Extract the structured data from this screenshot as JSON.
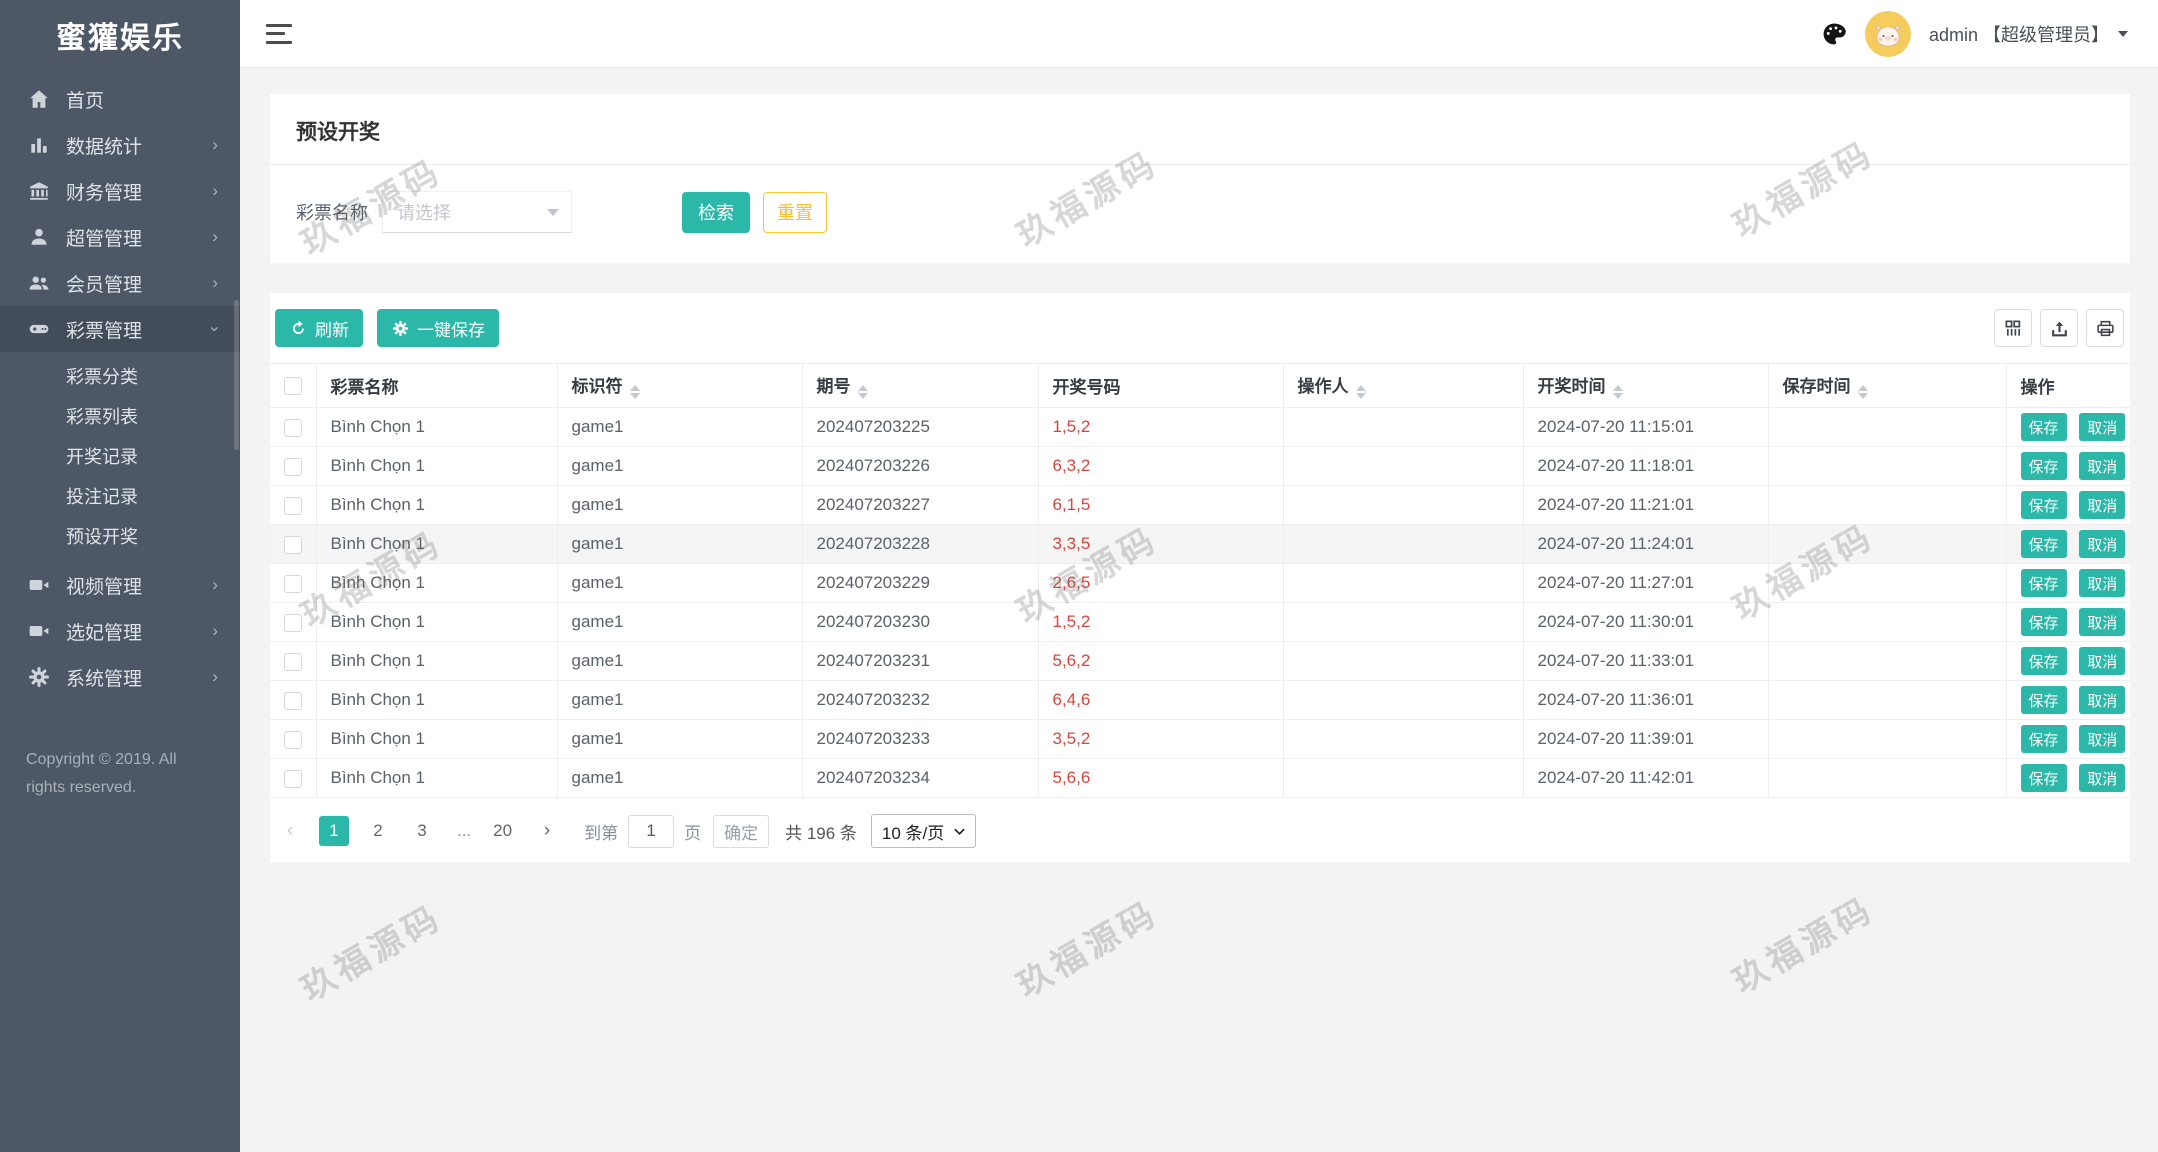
{
  "app": {
    "logo": "蜜獾娱乐",
    "copyright": "Copyright © 2019. All rights reserved.",
    "watermark": "玖福源码"
  },
  "colors": {
    "accent_teal": "#2bb8a8",
    "warning_yellow": "#fbc531",
    "danger_red": "#d9453c",
    "sidebar_bg": "#4d5766"
  },
  "header": {
    "admin_label": "admin 【超级管理员】"
  },
  "sidebar": {
    "items": [
      {
        "label": "首页",
        "icon": "home-icon"
      },
      {
        "label": "数据统计",
        "icon": "chart-icon"
      },
      {
        "label": "财务管理",
        "icon": "bank-icon"
      },
      {
        "label": "超管管理",
        "icon": "user-icon"
      },
      {
        "label": "会员管理",
        "icon": "users-icon"
      },
      {
        "label": "彩票管理",
        "icon": "gamepad-icon",
        "children": [
          {
            "label": "彩票分类"
          },
          {
            "label": "彩票列表"
          },
          {
            "label": "开奖记录"
          },
          {
            "label": "投注记录"
          },
          {
            "label": "预设开奖"
          }
        ]
      },
      {
        "label": "视频管理",
        "icon": "video-icon"
      },
      {
        "label": "选妃管理",
        "icon": "video-icon"
      },
      {
        "label": "系统管理",
        "icon": "gear-icon"
      }
    ]
  },
  "page": {
    "title": "预设开奖"
  },
  "filter": {
    "label": "彩票名称",
    "select_placeholder": "请选择",
    "search_label": "检索",
    "reset_label": "重置"
  },
  "toolbar": {
    "refresh_label": "刷新",
    "save_all_label": "一键保存"
  },
  "table": {
    "columns": [
      {
        "label": "彩票名称"
      },
      {
        "label": "标识符"
      },
      {
        "label": "期号"
      },
      {
        "label": "开奖号码"
      },
      {
        "label": "操作人"
      },
      {
        "label": "开奖时间"
      },
      {
        "label": "保存时间"
      },
      {
        "label": "操作"
      }
    ],
    "action_save": "保存",
    "action_cancel": "取消",
    "rows": [
      {
        "name": "Bình Chọn 1",
        "code": "game1",
        "issue": "202407203225",
        "numbers": "1,5,2",
        "operator": "",
        "draw_time": "2024-07-20 11:15:01",
        "save_time": ""
      },
      {
        "name": "Bình Chọn 1",
        "code": "game1",
        "issue": "202407203226",
        "numbers": "6,3,2",
        "operator": "",
        "draw_time": "2024-07-20 11:18:01",
        "save_time": ""
      },
      {
        "name": "Bình Chọn 1",
        "code": "game1",
        "issue": "202407203227",
        "numbers": "6,1,5",
        "operator": "",
        "draw_time": "2024-07-20 11:21:01",
        "save_time": ""
      },
      {
        "name": "Bình Chọn 1",
        "code": "game1",
        "issue": "202407203228",
        "numbers": "3,3,5",
        "operator": "",
        "draw_time": "2024-07-20 11:24:01",
        "save_time": ""
      },
      {
        "name": "Bình Chọn 1",
        "code": "game1",
        "issue": "202407203229",
        "numbers": "2,6,5",
        "operator": "",
        "draw_time": "2024-07-20 11:27:01",
        "save_time": ""
      },
      {
        "name": "Bình Chọn 1",
        "code": "game1",
        "issue": "202407203230",
        "numbers": "1,5,2",
        "operator": "",
        "draw_time": "2024-07-20 11:30:01",
        "save_time": ""
      },
      {
        "name": "Bình Chọn 1",
        "code": "game1",
        "issue": "202407203231",
        "numbers": "5,6,2",
        "operator": "",
        "draw_time": "2024-07-20 11:33:01",
        "save_time": ""
      },
      {
        "name": "Bình Chọn 1",
        "code": "game1",
        "issue": "202407203232",
        "numbers": "6,4,6",
        "operator": "",
        "draw_time": "2024-07-20 11:36:01",
        "save_time": ""
      },
      {
        "name": "Bình Chọn 1",
        "code": "game1",
        "issue": "202407203233",
        "numbers": "3,5,2",
        "operator": "",
        "draw_time": "2024-07-20 11:39:01",
        "save_time": ""
      },
      {
        "name": "Bình Chọn 1",
        "code": "game1",
        "issue": "202407203234",
        "numbers": "5,6,6",
        "operator": "",
        "draw_time": "2024-07-20 11:42:01",
        "save_time": ""
      }
    ]
  },
  "pagination": {
    "prev": "‹",
    "next": "›",
    "pages": [
      "1",
      "2",
      "3",
      "...",
      "20"
    ],
    "goto_label": "到第",
    "goto_value": "1",
    "goto_suffix": "页",
    "confirm_label": "确定",
    "total_label": "共 196 条",
    "page_size_label": "10 条/页"
  }
}
